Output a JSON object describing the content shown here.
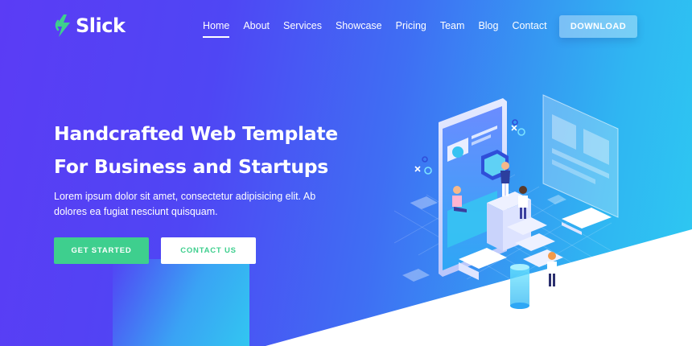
{
  "brand": {
    "name": "Slick",
    "logo_icon": "lightning-icon",
    "accent": "#3ecf8e"
  },
  "nav": {
    "items": [
      {
        "label": "Home",
        "active": true
      },
      {
        "label": "About",
        "active": false
      },
      {
        "label": "Services",
        "active": false
      },
      {
        "label": "Showcase",
        "active": false
      },
      {
        "label": "Pricing",
        "active": false
      },
      {
        "label": "Team",
        "active": false
      },
      {
        "label": "Blog",
        "active": false
      },
      {
        "label": "Contact",
        "active": false
      }
    ],
    "download_label": "DOWNLOAD"
  },
  "hero": {
    "title_line1": "Handcrafted Web Template",
    "title_line2": "For Business and Startups",
    "text": "Lorem ipsum dolor sit amet, consectetur adipisicing elit. Ab dolores ea fugiat nesciunt quisquam.",
    "primary_label": "GET STARTED",
    "secondary_label": "CONTACT US"
  },
  "colors": {
    "gradient_start": "#5b3cf5",
    "gradient_end": "#2ecaf1",
    "button_green": "#3ecf8e"
  }
}
